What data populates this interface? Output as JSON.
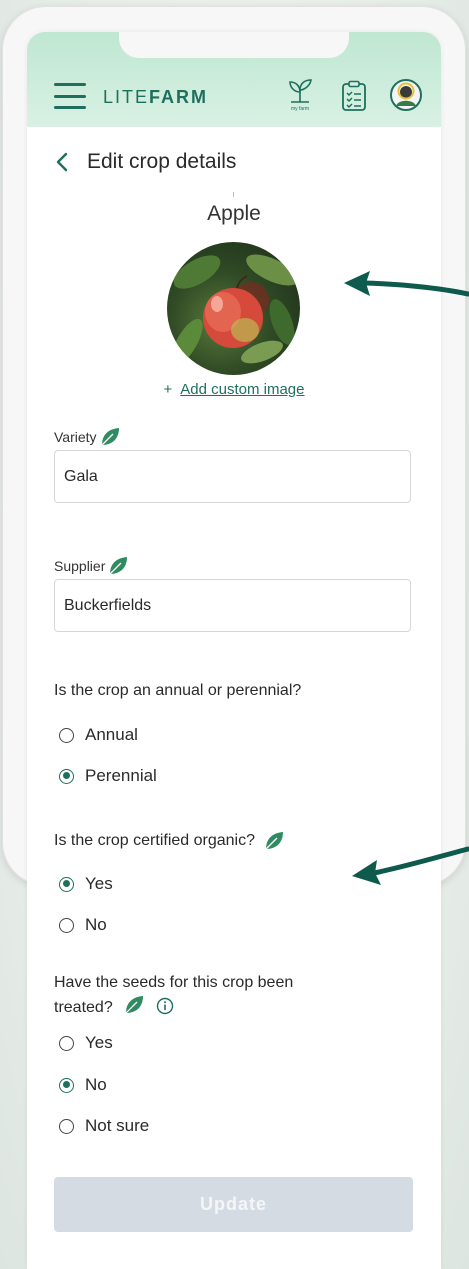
{
  "header": {
    "logo_lite": "LITE",
    "logo_farm": "FARM",
    "my_farm_caption": "my farm"
  },
  "page": {
    "title": "Edit crop details",
    "crop_name": "Apple",
    "add_image_plus": "+",
    "add_image_label": "Add custom image"
  },
  "fields": {
    "variety_label": "Variety",
    "variety_value": "Gala",
    "supplier_label": "Supplier",
    "supplier_value": "Buckerfields"
  },
  "questions": {
    "lifecycle": {
      "text": "Is the crop an annual or perennial?",
      "options": [
        "Annual",
        "Perennial"
      ],
      "selected": "Perennial"
    },
    "organic": {
      "text": "Is the crop certified organic?",
      "options": [
        "Yes",
        "No"
      ],
      "selected": "Yes"
    },
    "treated": {
      "text": "Have the seeds for this crop been treated?",
      "options": [
        "Yes",
        "No",
        "Not sure"
      ],
      "selected": "No"
    }
  },
  "actions": {
    "update_label": "Update"
  },
  "colors": {
    "brand_green": "#1f6f5e",
    "leaf_green": "#2e8b62",
    "header_gradient_top": "#bfe7d2",
    "button_disabled": "#d5dbe3"
  },
  "icons": {
    "menu": "hamburger-menu-icon",
    "farm": "seedling-my-farm-icon",
    "tasks": "clipboard-checklist-icon",
    "profile": "avatar-icon",
    "back": "chevron-left-icon",
    "certified": "leaf-icon",
    "info": "info-circle-icon"
  }
}
